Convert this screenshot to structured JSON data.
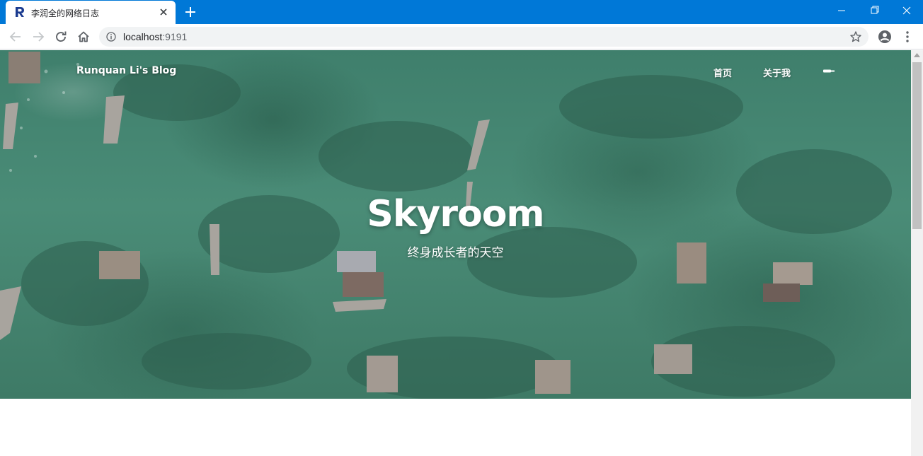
{
  "browser": {
    "tab": {
      "title": "李润全的网络日志",
      "favicon": "r-logo-icon",
      "close_icon": "close-icon"
    },
    "new_tab_icon": "plus-icon",
    "window_controls": [
      "minimize-icon",
      "restore-icon",
      "close-icon"
    ],
    "toolbar": {
      "back_icon": "arrow-left-icon",
      "forward_icon": "arrow-right-icon",
      "reload_icon": "reload-icon",
      "home_icon": "home-icon",
      "url_host": "localhost",
      "url_port": ":9191",
      "info_icon": "info-icon",
      "bookmark_icon": "star-icon",
      "profile_icon": "account-icon",
      "menu_icon": "vertical-dots-icon"
    },
    "colors": {
      "titlebar": "#0078d7",
      "favicon": "#1a3a8f"
    }
  },
  "site": {
    "brand": "Runquan Li's Blog",
    "nav": [
      {
        "label": "首页"
      },
      {
        "label": "关于我"
      }
    ],
    "nav_toggle_icon": "menu-toggle-icon",
    "hero": {
      "title": "Skyroom",
      "subtitle": "终身成长者的天空"
    }
  }
}
